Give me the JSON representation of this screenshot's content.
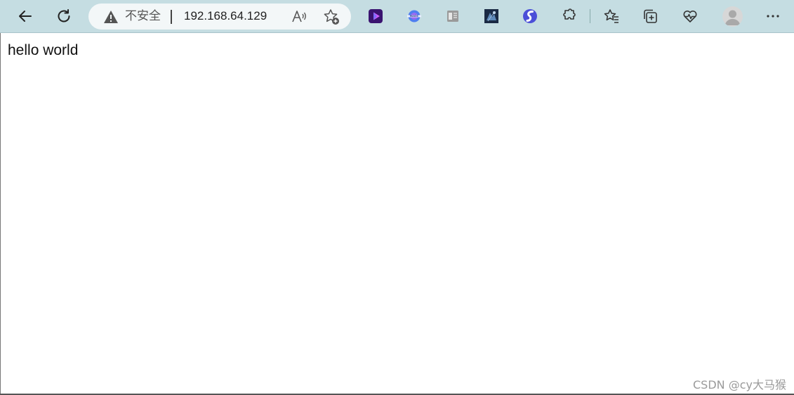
{
  "browser": {
    "address_bar": {
      "security_status": "不安全",
      "url": "192.168.64.129"
    },
    "toolbar_icons": [
      "back-arrow-icon",
      "refresh-icon",
      "warning-icon",
      "read-aloud-icon",
      "add-favorite-icon",
      "extension-purple-play-icon",
      "extension-magic-icon",
      "extension-reader-icon",
      "extension-dark-image-icon",
      "extension-blue-s-icon",
      "extensions-puzzle-icon",
      "favorites-icon",
      "collections-icon",
      "browser-essentials-icon",
      "profile-avatar",
      "more-options-icon"
    ],
    "colors": {
      "toolbar_bg": "#c5dde2",
      "address_bg": "#f3f7f8"
    }
  },
  "page": {
    "content_text": "hello world"
  },
  "watermark": {
    "text": "CSDN @cy大马猴"
  }
}
